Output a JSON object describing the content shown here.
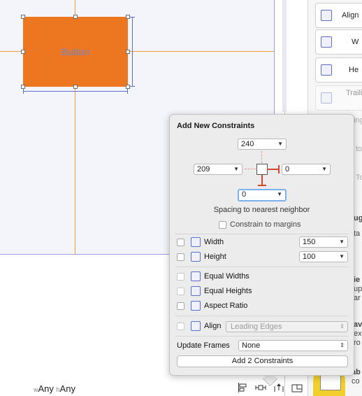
{
  "canvas": {
    "button_label": "Button",
    "size_class": {
      "w_prefix": "w",
      "w_value": "Any",
      "h_prefix": "h",
      "h_value": "Any"
    }
  },
  "bottom_tools": [
    "align-tool-icon",
    "pin-tool-icon",
    "resolve-tool-icon",
    "resizing-tool-icon"
  ],
  "inspector": {
    "items": [
      {
        "label": "Align"
      },
      {
        "label": "W"
      },
      {
        "label": "He"
      },
      {
        "label": "Trailing"
      }
    ],
    "clipped": [
      "ding",
      "to",
      "To",
      "ug",
      "ta",
      "ie",
      "up",
      "ar",
      "av",
      "ex",
      "ro",
      "ab",
      "co"
    ]
  },
  "popover": {
    "title": "Add New Constraints",
    "top_value": "240",
    "left_value": "209",
    "right_value": "0",
    "bottom_value": "0",
    "spacing_label": "Spacing to nearest neighbor",
    "constrain_margins": "Constrain to margins",
    "width_label": "Width",
    "width_value": "150",
    "height_label": "Height",
    "height_value": "100",
    "equal_widths": "Equal Widths",
    "equal_heights": "Equal Heights",
    "aspect_ratio": "Aspect Ratio",
    "align_label": "Align",
    "align_value": "Leading Edges",
    "update_frames_label": "Update Frames",
    "update_frames_value": "None",
    "add_button": "Add 2 Constraints"
  },
  "colors": {
    "button_fill": "#ed7621",
    "guide": "#f0a030",
    "accent": "#5a6fc7",
    "constraint_red": "#d34a2b"
  }
}
